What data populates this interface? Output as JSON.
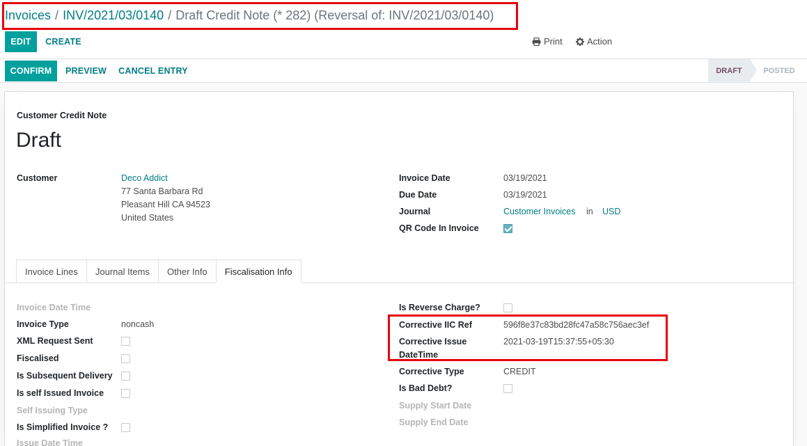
{
  "breadcrumb": {
    "root": "Invoices",
    "invoice": "INV/2021/03/0140",
    "current": "Draft Credit Note (* 282) (Reversal of: INV/2021/03/0140)",
    "separator": "/"
  },
  "toolbar": {
    "edit_label": "EDIT",
    "create_label": "CREATE",
    "print_label": "Print",
    "action_label": "Action"
  },
  "statusbar": {
    "confirm_label": "CONFIRM",
    "preview_label": "PREVIEW",
    "cancel_label": "CANCEL ENTRY",
    "stages": [
      "DRAFT",
      "POSTED"
    ],
    "active_stage": "DRAFT"
  },
  "sheet": {
    "subtitle": "Customer Credit Note",
    "title": "Draft"
  },
  "customer": {
    "label": "Customer",
    "name": "Deco Addict",
    "address_line1": "77 Santa Barbara Rd",
    "address_line2": "Pleasant Hill CA 94523",
    "country": "United States"
  },
  "invoice_info": {
    "invoice_date_label": "Invoice Date",
    "invoice_date": "03/19/2021",
    "due_date_label": "Due Date",
    "due_date": "03/19/2021",
    "journal_label": "Journal",
    "journal": "Customer Invoices",
    "journal_in": "in",
    "currency": "USD",
    "qr_label": "QR Code In Invoice",
    "qr_checked": true
  },
  "tabs": [
    "Invoice Lines",
    "Journal Items",
    "Other Info",
    "Fiscalisation Info"
  ],
  "active_tab": "Fiscalisation Info",
  "fiscal_left": {
    "invoice_datetime_label": "Invoice Date Time",
    "invoice_type_label": "Invoice Type",
    "invoice_type": "noncash",
    "xml_sent_label": "XML Request Sent",
    "fiscalised_label": "Fiscalised",
    "subsequent_label": "Is Subsequent Delivery",
    "self_issued_label": "Is self Issued Invoice",
    "self_issuing_type_label": "Self Issuing Type",
    "simplified_label": "Is Simplified Invoice ?",
    "issue_datetime_label": "Issue Date Time"
  },
  "fiscal_right": {
    "reverse_charge_label": "Is Reverse Charge?",
    "corrective_iic_label": "Corrective IIC Ref",
    "corrective_iic": "596f8e37c83bd28fc47a58c756aec3ef",
    "corrective_issue_label_1": "Corrective Issue",
    "corrective_issue_label_2": "DateTime",
    "corrective_issue": "2021-03-19T15:37:55+05:30",
    "corrective_type_label": "Corrective Type",
    "corrective_type": "CREDIT",
    "bad_debt_label": "Is Bad Debt?",
    "supply_start_label": "Supply Start Date",
    "supply_end_label": "Supply End Date"
  },
  "colors": {
    "primary": "#00a09d",
    "link": "#017e84",
    "highlight": "#e8000b",
    "status_active": "#714b67"
  }
}
